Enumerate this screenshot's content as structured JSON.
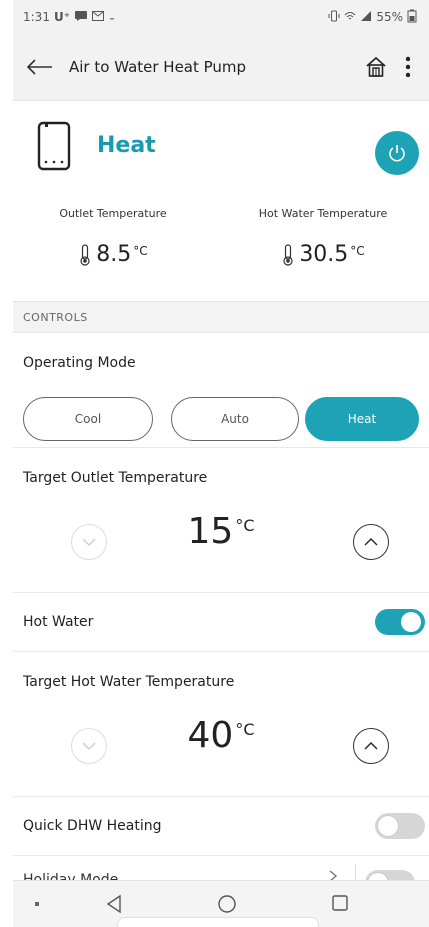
{
  "status_bar": {
    "time": "1:31",
    "carrier": "U⁺",
    "battery": "55%",
    "icons": [
      "message-icon",
      "mail-icon",
      "vibrate-icon",
      "wifi-icon",
      "signal-icon",
      "battery-icon"
    ]
  },
  "app_bar": {
    "title": "Air to Water Heat Pump",
    "icons": [
      "back-arrow-icon",
      "home-icon",
      "more-vert-icon"
    ]
  },
  "mode_card": {
    "mode": "Heat",
    "outlet_label": "Outlet Temperature",
    "outlet_value": "8.5",
    "hot_water_label": "Hot Water Temperature",
    "hot_water_value": "30.5",
    "unit": "°C",
    "accent": "#1ea2b6"
  },
  "controls": {
    "header": "CONTROLS",
    "operating_mode": {
      "label": "Operating Mode",
      "options": [
        "Cool",
        "Auto",
        "Heat"
      ],
      "selected": "Heat"
    },
    "target_outlet": {
      "label": "Target Outlet Temperature",
      "value": "15",
      "unit": "°C"
    },
    "hot_water": {
      "label": "Hot Water",
      "on": true
    },
    "target_hot_water": {
      "label": "Target Hot Water Temperature",
      "value": "40",
      "unit": "°C"
    },
    "quick_dhw": {
      "label": "Quick DHW Heating",
      "on": false
    },
    "holiday_mode": {
      "label": "Holiday Mode",
      "on": false
    }
  },
  "nav_bar": {
    "icons": [
      "nav-dot-icon",
      "nav-back-icon",
      "nav-home-icon",
      "nav-recents-icon"
    ]
  }
}
